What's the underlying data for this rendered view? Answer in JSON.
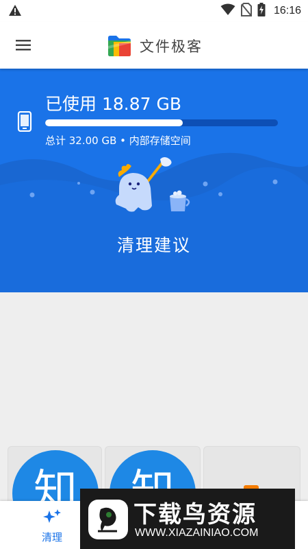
{
  "status_bar": {
    "time": "16:16",
    "icons": [
      "warning-icon",
      "wifi-icon",
      "no-sim-icon",
      "battery-charging-icon"
    ]
  },
  "app_bar": {
    "title": "文件极客",
    "icons": [
      "menu-icon",
      "app-logo-icon"
    ]
  },
  "storage": {
    "used_text": "已使用 18.87 GB",
    "total_text": "总计 32.00 GB • 内部存储空间",
    "used_fraction": 0.59,
    "icon": "phone-icon"
  },
  "hero": {
    "cta_text": "清理建议",
    "illustration": "cleaning-mascot-illustration",
    "accent_color": "#1a73e8"
  },
  "cards": [
    {
      "avatar_text": "知",
      "avatar_color": "#1e88e5"
    },
    {
      "avatar_text": "知",
      "avatar_color": "#1e88e5"
    },
    {
      "avatar_text": "",
      "badge_color": "#f57c00"
    }
  ],
  "bottom_nav": {
    "items": [
      {
        "label": "清理",
        "icon": "sparkle-icon",
        "active": true
      }
    ]
  },
  "watermark": {
    "title": "下载鸟资源",
    "url": "WWW.XIAZAINIAO.COM"
  }
}
